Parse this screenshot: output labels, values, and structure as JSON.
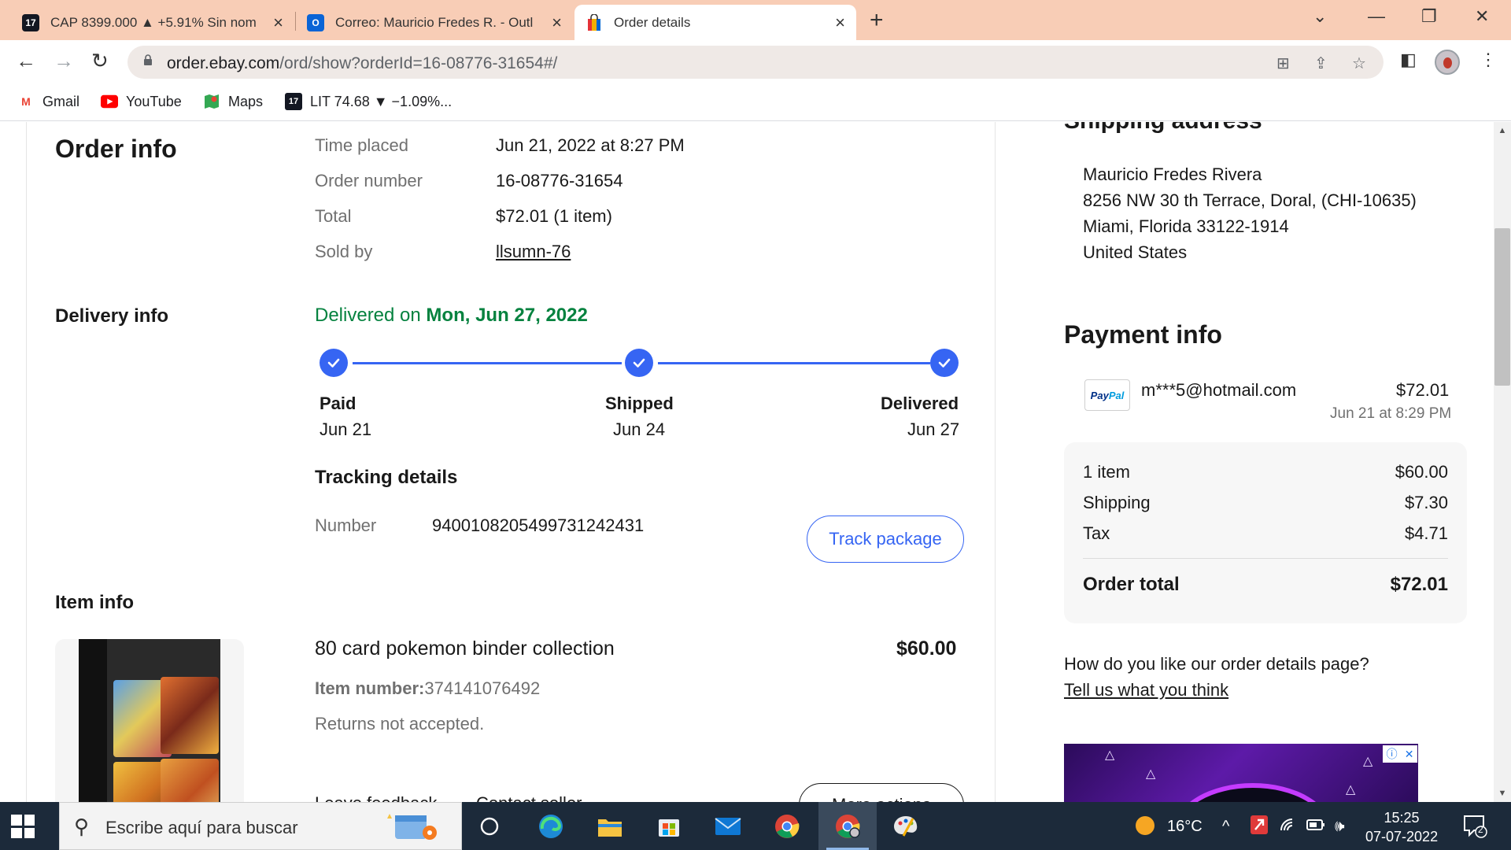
{
  "browser": {
    "tabs": [
      {
        "title": "CAP 8399.000 ▲ +5.91% Sin nom",
        "favicon": "tradingview-icon"
      },
      {
        "title": "Correo: Mauricio Fredes R. - Outl",
        "favicon": "outlook-icon"
      },
      {
        "title": "Order details",
        "favicon": "ebay-bag-icon"
      }
    ],
    "url_host": "order.ebay.com",
    "url_path": "/ord/show?orderId=16-08776-31654#/",
    "bookmarks": [
      {
        "label": "Gmail",
        "icon": "gmail-icon"
      },
      {
        "label": "YouTube",
        "icon": "youtube-icon"
      },
      {
        "label": "Maps",
        "icon": "maps-icon"
      },
      {
        "label": "LIT 74.68 ▼ −1.09%...",
        "icon": "tradingview-icon"
      }
    ]
  },
  "order_info": {
    "heading": "Order info",
    "time_placed_label": "Time placed",
    "time_placed": "Jun 21, 2022 at 8:27 PM",
    "order_number_label": "Order number",
    "order_number": "16-08776-31654",
    "total_label": "Total",
    "total": "$72.01 (1 item)",
    "sold_by_label": "Sold by",
    "sold_by": "llsumn-76"
  },
  "delivery_info": {
    "heading": "Delivery info",
    "status_prefix": "Delivered on ",
    "status_date": "Mon, Jun 27, 2022",
    "steps": [
      {
        "name": "Paid",
        "date": "Jun 21"
      },
      {
        "name": "Shipped",
        "date": "Jun 24"
      },
      {
        "name": "Delivered",
        "date": "Jun 27"
      }
    ],
    "tracking_heading": "Tracking details",
    "number_label": "Number",
    "tracking_number": "9400108205499731242431",
    "track_button": "Track package"
  },
  "item_info": {
    "heading": "Item info",
    "title": "80 card pokemon binder collection",
    "price": "$60.00",
    "item_number_label": "Item number:",
    "item_number": "374141076492",
    "returns": "Returns not accepted.",
    "leave_feedback": "Leave feedback",
    "contact_seller": "Contact seller",
    "more_actions": "More actions"
  },
  "shipping_address": {
    "heading": "Shipping address",
    "lines": [
      "Mauricio Fredes Rivera",
      "8256 NW 30 th Terrace,  Doral, (CHI-10635)",
      "Miami, Florida 33122-1914",
      "United States"
    ]
  },
  "payment_info": {
    "heading": "Payment info",
    "method_brand": "PayPal",
    "account": "m***5@hotmail.com",
    "amount": "$72.01",
    "date": "Jun 21 at 8:29 PM",
    "summary": [
      {
        "label": "1 item",
        "value": "$60.00"
      },
      {
        "label": "Shipping",
        "value": "$7.30"
      },
      {
        "label": "Tax",
        "value": "$4.71"
      }
    ],
    "order_total_label": "Order total",
    "order_total": "$72.01"
  },
  "feedback": {
    "question": "How do you like our order details page?",
    "link": "Tell us what you think"
  },
  "taskbar": {
    "search_placeholder": "Escribe aquí para buscar",
    "weather": "16°C",
    "time": "15:25",
    "date": "07-07-2022",
    "notifications": "2"
  },
  "colors": {
    "accent_blue": "#3665f3",
    "delivered_green": "#05823f",
    "tab_bar": "#f8cdb6",
    "taskbar": "#1c2a3a"
  }
}
